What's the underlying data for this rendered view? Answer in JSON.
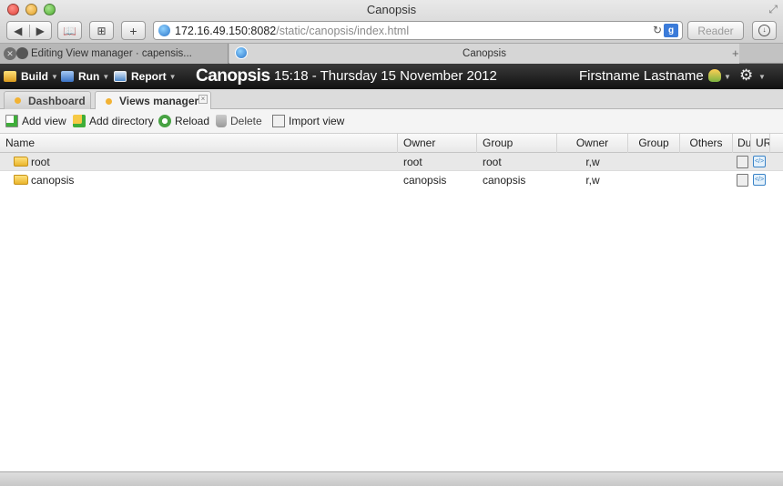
{
  "window": {
    "title": "Canopsis",
    "url_host": "172.16.49.150:8082",
    "url_path": "/static/canopsis/index.html",
    "reader_label": "Reader",
    "google_label": "g"
  },
  "browser_tabs": [
    {
      "label": "Editing View manager · capensis..."
    },
    {
      "label": "Canopsis"
    }
  ],
  "appbar": {
    "menus": [
      {
        "label": "Build"
      },
      {
        "label": "Run"
      },
      {
        "label": "Report"
      }
    ],
    "brand": "Canopsis",
    "clock": "15:18 - Thursday 15 November 2012",
    "username": "Firstname Lastname"
  },
  "app_tabs": [
    {
      "label": "Dashboard",
      "active": false
    },
    {
      "label": "Views manager",
      "active": true
    }
  ],
  "actions": {
    "add_view": "Add view",
    "add_directory": "Add directory",
    "reload": "Reload",
    "delete": "Delete",
    "import_view": "Import view"
  },
  "grid": {
    "columns": [
      "Name",
      "Owner",
      "Group",
      "Owner",
      "Group",
      "Others",
      "Du",
      "UR"
    ],
    "rows": [
      {
        "name": "root",
        "owner": "root",
        "group": "root",
        "rights_owner": "r,w",
        "selected": true
      },
      {
        "name": "canopsis",
        "owner": "canopsis",
        "group": "canopsis",
        "rights_owner": "r,w",
        "selected": false
      }
    ]
  },
  "colors": {
    "appbar": "#1c1c1c",
    "accent_dot": "#f2b233",
    "selected_row": "#e8e8e8"
  }
}
